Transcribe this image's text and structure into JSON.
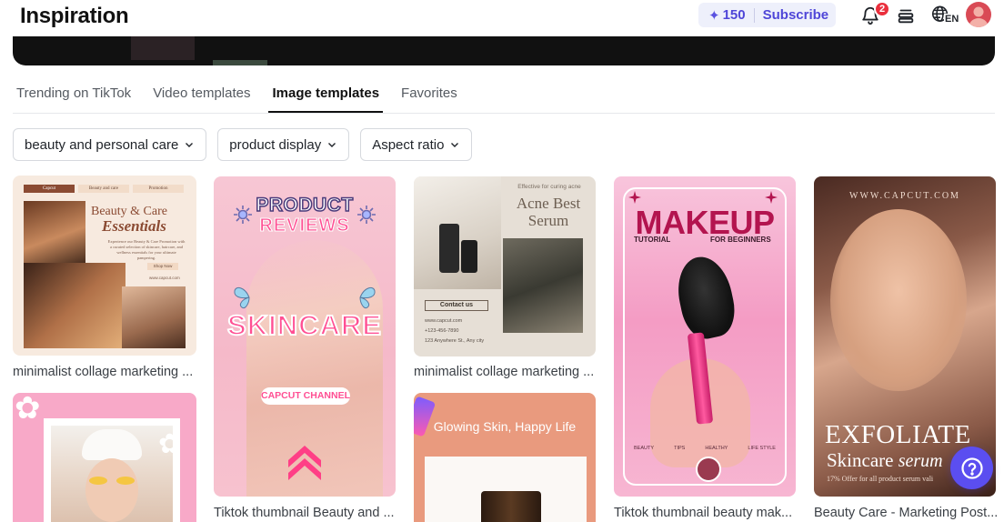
{
  "header": {
    "title": "Inspiration",
    "credits": "150",
    "subscribe_label": "Subscribe",
    "notification_count": "2",
    "language": "EN"
  },
  "tabs": [
    {
      "label": "Trending on TikTok",
      "active": false
    },
    {
      "label": "Video templates",
      "active": false
    },
    {
      "label": "Image templates",
      "active": true
    },
    {
      "label": "Favorites",
      "active": false
    }
  ],
  "filters": [
    {
      "label": "beauty and personal care"
    },
    {
      "label": "product display"
    },
    {
      "label": "Aspect ratio"
    }
  ],
  "templates": [
    {
      "caption": "minimalist collage marketing ...",
      "art": {
        "nav": [
          "Capcut",
          "Beauty and care",
          "Promotion"
        ],
        "heading_1": "Beauty & Care",
        "heading_2": "Essentials",
        "body": "Experience our Beauty & Care Promotion with a curated selection of skincare, haircare, and wellness essentials for your ultimate pampering.",
        "button": "Shop Now",
        "site": "www.capcut.com"
      }
    },
    {
      "caption": "Tiktok thumbnail Beauty and ...",
      "art": {
        "line_1": "PRODUCT",
        "line_2": "REVIEWS",
        "line_3": "SKINCARE",
        "pill": "CAPCUT CHANNEL"
      }
    },
    {
      "caption": "minimalist collage marketing ...",
      "art": {
        "kicker": "Effective for curing acne",
        "heading": "Acne Best Serum",
        "button": "Contact us",
        "info": [
          "www.capcut.com",
          "+123-456-7890",
          "123 Anywhere St., Any city"
        ]
      }
    },
    {
      "caption": "Tiktok thumbnail beauty mak...",
      "art": {
        "title": "MAKEUP",
        "sub_left": "TUTORIAL",
        "sub_right": "FOR BEGINNERS",
        "categories": [
          "BEAUTY",
          "TIPS",
          "HEALTHY",
          "LIFE STYLE"
        ]
      }
    },
    {
      "caption": "Beauty Care - Marketing Post...",
      "art": {
        "site": "WWW.CAPCUT.COM",
        "title": "EXFOLIATE",
        "subtitle": "Skincare",
        "subtitle_italic": "serum",
        "offer": "17% Offer for all product serum vali"
      }
    },
    {
      "caption": "",
      "art": {}
    },
    {
      "caption": "",
      "art": {
        "headline": "Glowing Skin, Happy Life"
      }
    }
  ]
}
